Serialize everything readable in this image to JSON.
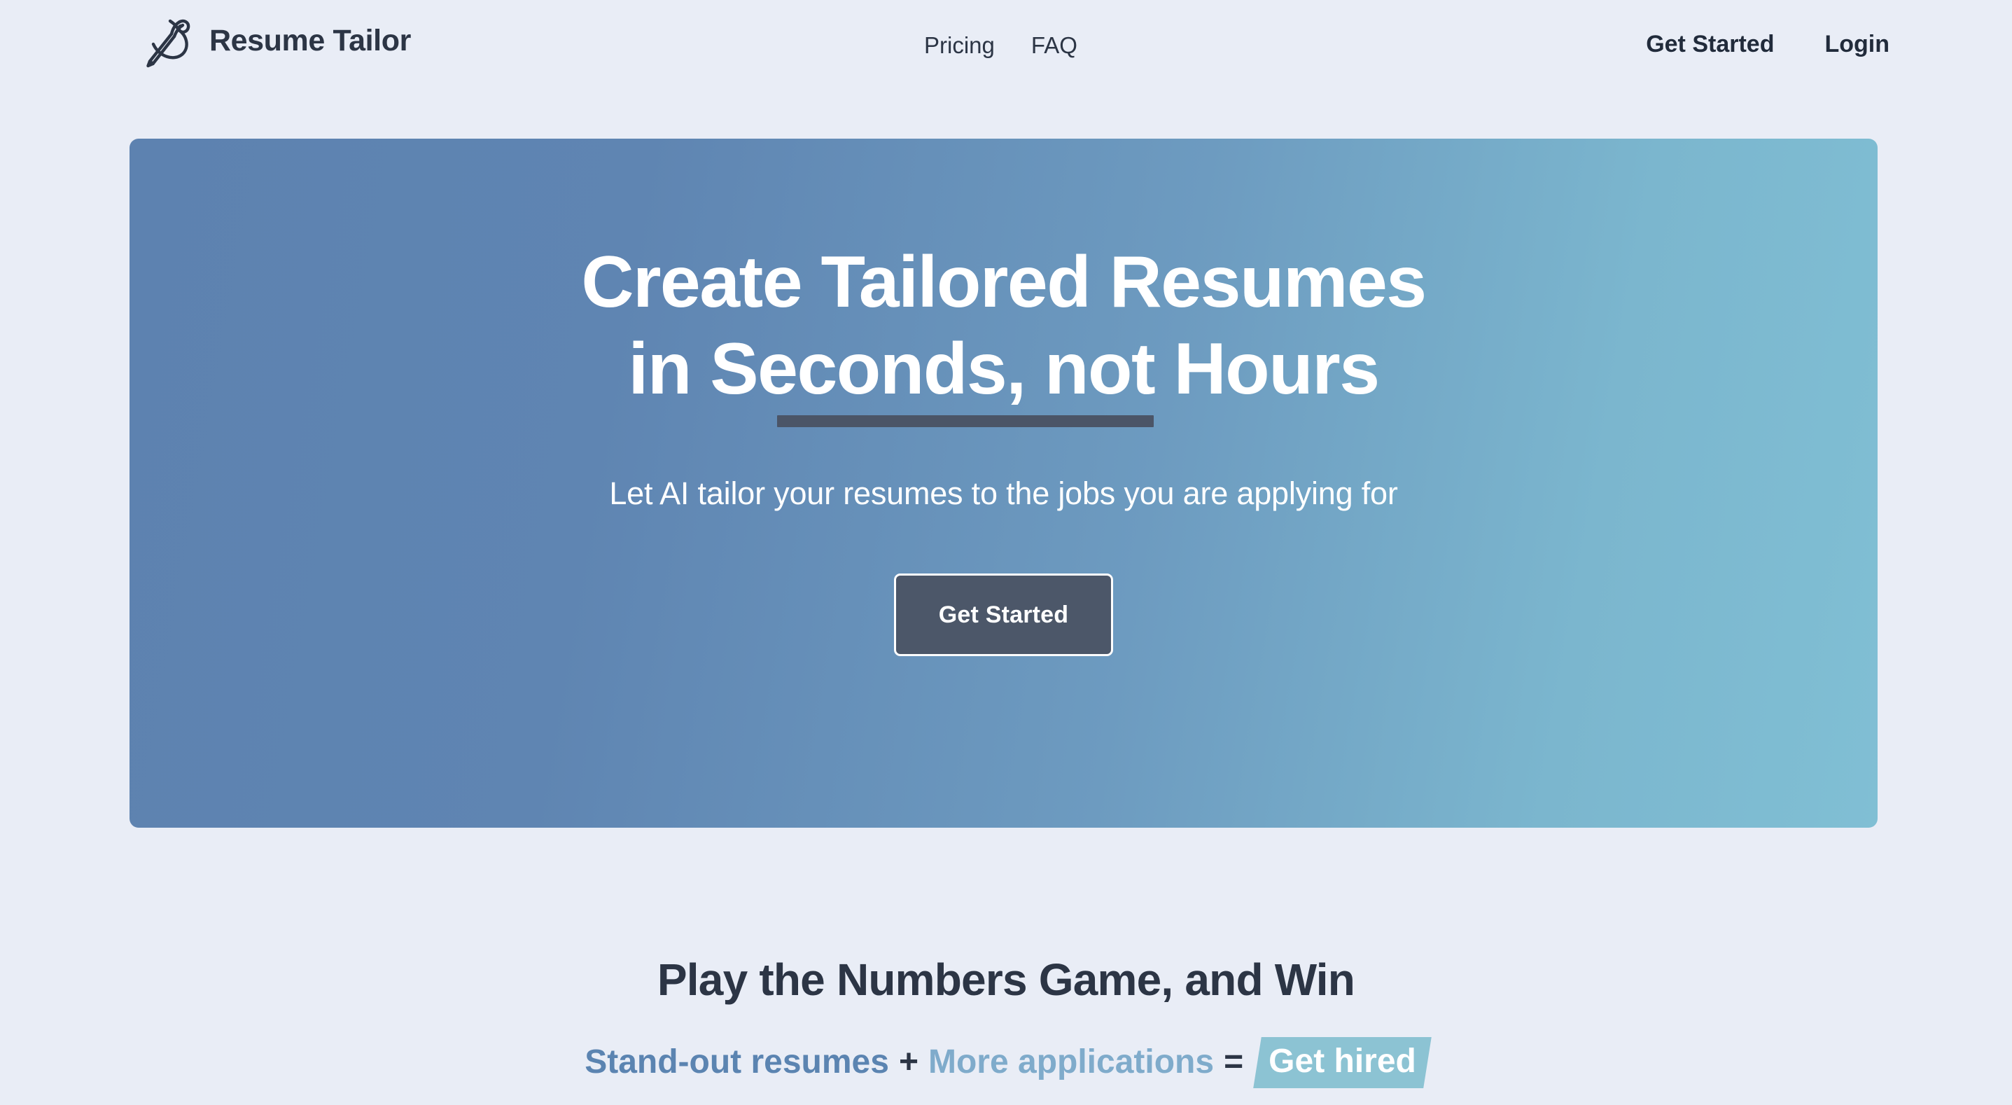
{
  "brand": {
    "name": "Resume Tailor",
    "icon": "needle-thread-icon"
  },
  "nav": {
    "center": [
      {
        "label": "Pricing",
        "name": "pricing"
      },
      {
        "label": "FAQ",
        "name": "faq"
      }
    ],
    "right": [
      {
        "label": "Get Started",
        "name": "get-started"
      },
      {
        "label": "Login",
        "name": "login"
      }
    ]
  },
  "hero": {
    "title_line1": "Create Tailored Resumes",
    "title_line2": "in Seconds, not Hours",
    "subtitle": "Let AI tailor your resumes to the jobs you are applying for",
    "cta_label": "Get Started",
    "gradient_start": "#5D82B0",
    "gradient_end": "#80BFD4",
    "underline_color": "#4B5567",
    "cta_bg": "#4C5769"
  },
  "numbers": {
    "title": "Play the Numbers Game, and Win",
    "formula": {
      "part1": "Stand-out resumes",
      "op1": "+",
      "part2": "More applications",
      "op2": "=",
      "part3": "Get hired"
    },
    "colors": {
      "part1": "#5B84B1",
      "part2": "#7FABCB",
      "highlight_bg": "#8CC3D3",
      "highlight_text": "#FFFFFF",
      "heading": "#2C3545"
    }
  },
  "page": {
    "background": "#E9EDF6"
  }
}
